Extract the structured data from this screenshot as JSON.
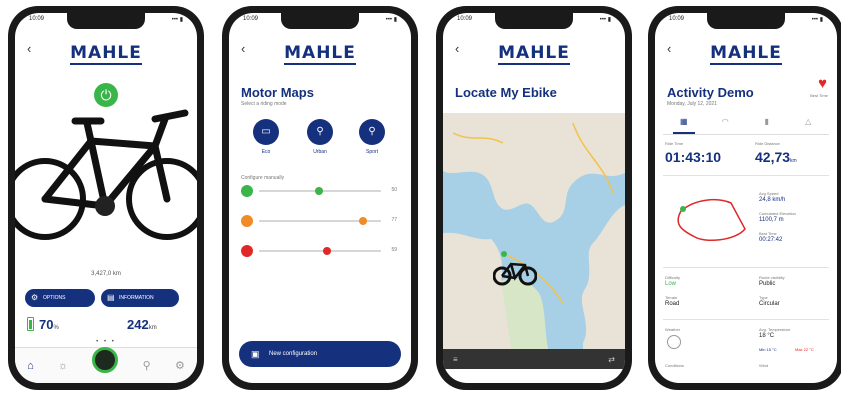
{
  "brand": {
    "logo": "MAHLE",
    "blue": "#15317e",
    "green": "#3ab54a",
    "red": "#e02828"
  },
  "status_bar": {
    "time": "10:09",
    "icons": "••• ▮"
  },
  "phone1": {
    "back_icon": "chevron-left-icon",
    "odometer": "3,427,0 km",
    "buttons": [
      {
        "label": "OPTIONS",
        "icon": "wrench-icon"
      },
      {
        "label": "INFORMATION",
        "icon": "folder-icon"
      }
    ],
    "battery": {
      "value": "70",
      "unit": "%",
      "level": 0.7
    },
    "range": {
      "value": "242",
      "unit": "km"
    },
    "page_dots": "• • •",
    "tabs": [
      "home-icon",
      "sun-icon",
      "power-dial-icon",
      "bike-icon",
      "gear-icon"
    ]
  },
  "phone2": {
    "title": "Motor Maps",
    "subtitle": "Select a riding mode",
    "modes": [
      {
        "label": "Eco",
        "icon": "battery-icon"
      },
      {
        "label": "Urban",
        "icon": "cyclist-icon"
      },
      {
        "label": "Sport",
        "icon": "cyclist-fast-icon"
      }
    ],
    "section": "Configure manually",
    "sliders": [
      {
        "color": "#3ab54a",
        "position": 0.48,
        "value": "50"
      },
      {
        "color": "#f08c28",
        "position": 0.86,
        "value": "77"
      },
      {
        "color": "#e02828",
        "position": 0.58,
        "value": "59"
      }
    ],
    "cta": "New configuration"
  },
  "phone3": {
    "title": "Locate My Ebike",
    "bar_left": "≡",
    "bar_right": "⇄"
  },
  "phone4": {
    "title": "Activity Demo",
    "date": "Monday, July 12, 2021",
    "heart_label": "Best Time",
    "tabs": [
      "map-icon",
      "speed-icon",
      "battery-icon",
      "mountain-icon"
    ],
    "ride_time_label": "Ride Time",
    "ride_time": "01:43:10",
    "distance_label": "Ride Distance",
    "distance": "42,73",
    "distance_unit": "km",
    "avg_speed_label": "Avg Speed",
    "avg_speed": "24,8 km/h",
    "elevation_label": "Cumulated Elevation",
    "elevation": "1100,7 m",
    "best_time_label": "Best Time",
    "best_time": "00:27:42",
    "difficulty_label": "Difficulty",
    "difficulty": "Low",
    "route_label": "Route visibility",
    "route": "Public",
    "terrain_label": "Terrain",
    "terrain": "Road",
    "type_label": "Type",
    "type": "Circular",
    "weather_label": "Weather",
    "temp_label": "Avg. Temperature",
    "temp": "18 °C",
    "conditions_label": "Conditions",
    "wind_label": "Wind",
    "min_temp": "Min 15 °C",
    "max_temp": "Max 22 °C"
  }
}
